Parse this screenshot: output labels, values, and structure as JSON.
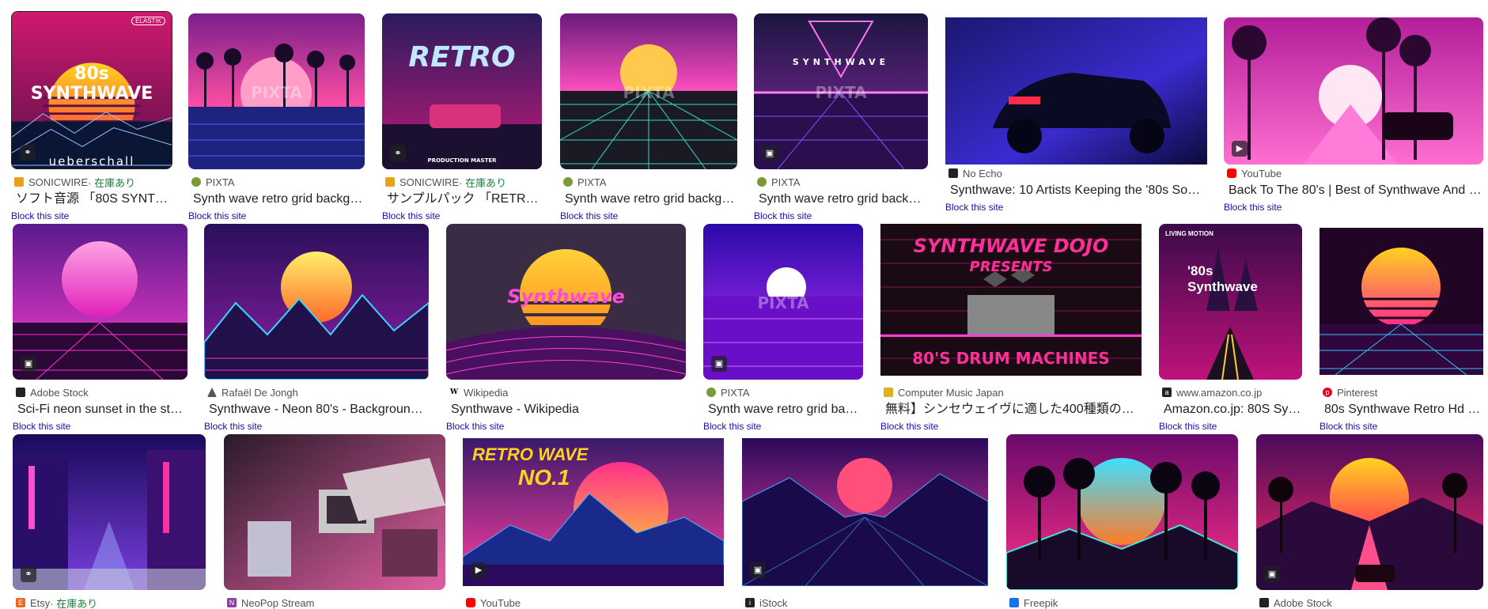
{
  "results": {
    "row1": [
      {
        "source": "SONICWIRE",
        "stock": " · 在庫あり",
        "title": "ソフト音源 「80S SYNTH…",
        "block": "Block this site",
        "art": "synth80s",
        "badge": "tag-icon",
        "text_top": "80s SYNTHWAVE",
        "text_bottom": "ueberschall",
        "corner": "ELASTIK"
      },
      {
        "source": "PIXTA",
        "stock": "",
        "title": "Synth wave retro grid backgr…",
        "block": "Block this site",
        "art": "palmsun",
        "badge": "",
        "wm": "PIXTA"
      },
      {
        "source": "SONICWIRE",
        "stock": " · 在庫あり",
        "title": "サンプルパック 「RETRO …",
        "block": "Block this site",
        "art": "retrowave",
        "badge": "tag-icon",
        "text_top": "RETRO",
        "text_bottom": "PRODUCTION MASTER"
      },
      {
        "source": "PIXTA",
        "stock": "",
        "title": "Synth wave retro grid backgr…",
        "block": "Block this site",
        "art": "gridsun",
        "badge": "",
        "wm": "PIXTA"
      },
      {
        "source": "PIXTA",
        "stock": "",
        "title": "Synth wave retro grid backgr…",
        "block": "Block this site",
        "art": "triangle",
        "badge": "image-icon",
        "text_top": "SYNTHWAVE",
        "wm": "PIXTA"
      },
      {
        "source": "No Echo",
        "stock": "",
        "title": "Synthwave: 10 Artists Keeping the '80s Sou…",
        "block": "Block this site",
        "art": "car",
        "badge": ""
      },
      {
        "source": "YouTube",
        "stock": "",
        "title": "Back To The 80's | Best of Synthwave And R…",
        "block": "Block this site",
        "art": "palmroad",
        "badge": "play-icon"
      }
    ],
    "row2": [
      {
        "source": "Adobe Stock",
        "stock": "",
        "title": "Sci-Fi neon sunset in the styl…",
        "block": "Block this site",
        "art": "neonsunset",
        "badge": "image-icon"
      },
      {
        "source": "Rafaël De Jongh",
        "stock": "",
        "title": "Synthwave - Neon 80's - Background …",
        "block": "Block this site",
        "art": "mountainsun",
        "badge": ""
      },
      {
        "source": "Wikipedia",
        "stock": "",
        "title": "Synthwave - Wikipedia",
        "block": "Block this site",
        "art": "wiki",
        "badge": "",
        "text_top": "Synthwave"
      },
      {
        "source": "PIXTA",
        "stock": "",
        "title": "Synth wave retro grid bac…",
        "block": "Block this site",
        "art": "purplesun",
        "badge": "image-icon",
        "wm": "PIXTA"
      },
      {
        "source": "Computer Music Japan",
        "stock": "",
        "title": "無料】シンセウェイヴに適した400種類のサ…",
        "block": "Block this site",
        "art": "dojo",
        "badge": "",
        "text_top": "SYNTHWAVE DOJO",
        "text_mid": "PRESENTS",
        "text_bottom": "80'S DRUM MACHINES"
      },
      {
        "source": "www.amazon.co.jp",
        "stock": "",
        "title": "Amazon.co.jp: 80S Syn…",
        "block": "Block this site",
        "art": "amazon",
        "badge": "",
        "corner": "LIVING MOTION",
        "text_top": "'80s",
        "text_mid": "Synthwave"
      },
      {
        "source": "Pinterest",
        "stock": "",
        "title": "80s Synthwave Retro Hd | …",
        "block": "Block this site",
        "art": "pinsun",
        "badge": ""
      }
    ],
    "row3": [
      {
        "source": "Etsy",
        "stock": " · 在庫あり",
        "art": "tokyo",
        "badge": "tag-icon"
      },
      {
        "source": "NeoPop Stream",
        "stock": "",
        "art": "retropc",
        "badge": ""
      },
      {
        "source": "YouTube",
        "stock": "",
        "art": "retrowaveno1",
        "badge": "play-icon",
        "text_top": "RETRO WAVE",
        "text_mid": "NO.1"
      },
      {
        "source": "iStock",
        "stock": "",
        "art": "istock",
        "badge": "image-icon"
      },
      {
        "source": "Freepik",
        "stock": "",
        "art": "freepik",
        "badge": ""
      },
      {
        "source": "Adobe Stock",
        "stock": "",
        "art": "adobecar",
        "badge": "image-icon"
      }
    ]
  },
  "favicon_colors": {
    "SONICWIRE": "#e8a21a",
    "PIXTA": "#7a9a3a",
    "No Echo": "#222222",
    "YouTube": "#ff0000",
    "Adobe Stock": "#222222",
    "Rafaël De Jongh": "#555555",
    "Wikipedia": "#ffffff",
    "Computer Music Japan": "#e0b020",
    "www.amazon.co.jp": "#222222",
    "Pinterest": "#e60023",
    "Etsy": "#f1641e",
    "NeoPop Stream": "#8a3fa0",
    "iStock": "#222222",
    "Freepik": "#1273eb"
  },
  "icons": {
    "tag-icon": "tag",
    "image-icon": "image",
    "play-icon": "play"
  }
}
